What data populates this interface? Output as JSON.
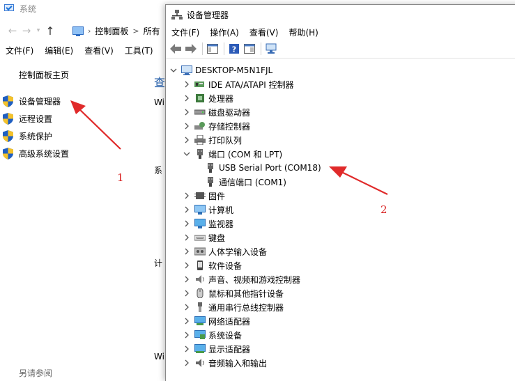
{
  "system_window": {
    "title": "系统",
    "address": {
      "seg1": "控制面板",
      "sep": ">",
      "seg2": "所有"
    },
    "menu": [
      "文件(F)",
      "编辑(E)",
      "查看(V)",
      "工具(T)"
    ],
    "cp_home": "控制面板主页",
    "tasks": [
      "设备管理器",
      "远程设置",
      "系统保护",
      "高级系统设置"
    ],
    "see_also": "另请参阅",
    "fragments": {
      "heading": "查",
      "f1": "Wi",
      "f2": "系",
      "f3": "计",
      "f4": "Wi"
    }
  },
  "device_manager": {
    "title": "设备管理器",
    "menu": [
      "文件(F)",
      "操作(A)",
      "查看(V)",
      "帮助(H)"
    ],
    "root": "DESKTOP-M5N1FJL",
    "nodes": [
      {
        "label": "IDE ATA/ATAPI 控制器",
        "icon": "ide-controller-icon",
        "expanded": false
      },
      {
        "label": "处理器",
        "icon": "processor-icon",
        "expanded": false
      },
      {
        "label": "磁盘驱动器",
        "icon": "disk-drive-icon",
        "expanded": false
      },
      {
        "label": "存储控制器",
        "icon": "storage-controller-icon",
        "expanded": false
      },
      {
        "label": "打印队列",
        "icon": "printer-icon",
        "expanded": false
      },
      {
        "label": "端口 (COM 和 LPT)",
        "icon": "port-icon",
        "expanded": true,
        "children": [
          {
            "label": "USB Serial Port (COM18)",
            "icon": "port-icon"
          },
          {
            "label": "通信端口 (COM1)",
            "icon": "port-icon"
          }
        ]
      },
      {
        "label": "固件",
        "icon": "firmware-icon",
        "expanded": false
      },
      {
        "label": "计算机",
        "icon": "computer-icon",
        "expanded": false
      },
      {
        "label": "监视器",
        "icon": "monitor-icon",
        "expanded": false
      },
      {
        "label": "键盘",
        "icon": "keyboard-icon",
        "expanded": false
      },
      {
        "label": "人体学输入设备",
        "icon": "hid-icon",
        "expanded": false
      },
      {
        "label": "软件设备",
        "icon": "software-device-icon",
        "expanded": false
      },
      {
        "label": "声音、视频和游戏控制器",
        "icon": "sound-icon",
        "expanded": false
      },
      {
        "label": "鼠标和其他指针设备",
        "icon": "mouse-icon",
        "expanded": false
      },
      {
        "label": "通用串行总线控制器",
        "icon": "usb-icon",
        "expanded": false
      },
      {
        "label": "网络适配器",
        "icon": "network-adapter-icon",
        "expanded": false
      },
      {
        "label": "系统设备",
        "icon": "system-device-icon",
        "expanded": false
      },
      {
        "label": "显示适配器",
        "icon": "display-adapter-icon",
        "expanded": false
      },
      {
        "label": "音频输入和输出",
        "icon": "audio-io-icon",
        "expanded": false
      }
    ]
  },
  "annotations": {
    "mark1": "1",
    "mark2": "2",
    "color": "#e02a2a"
  }
}
